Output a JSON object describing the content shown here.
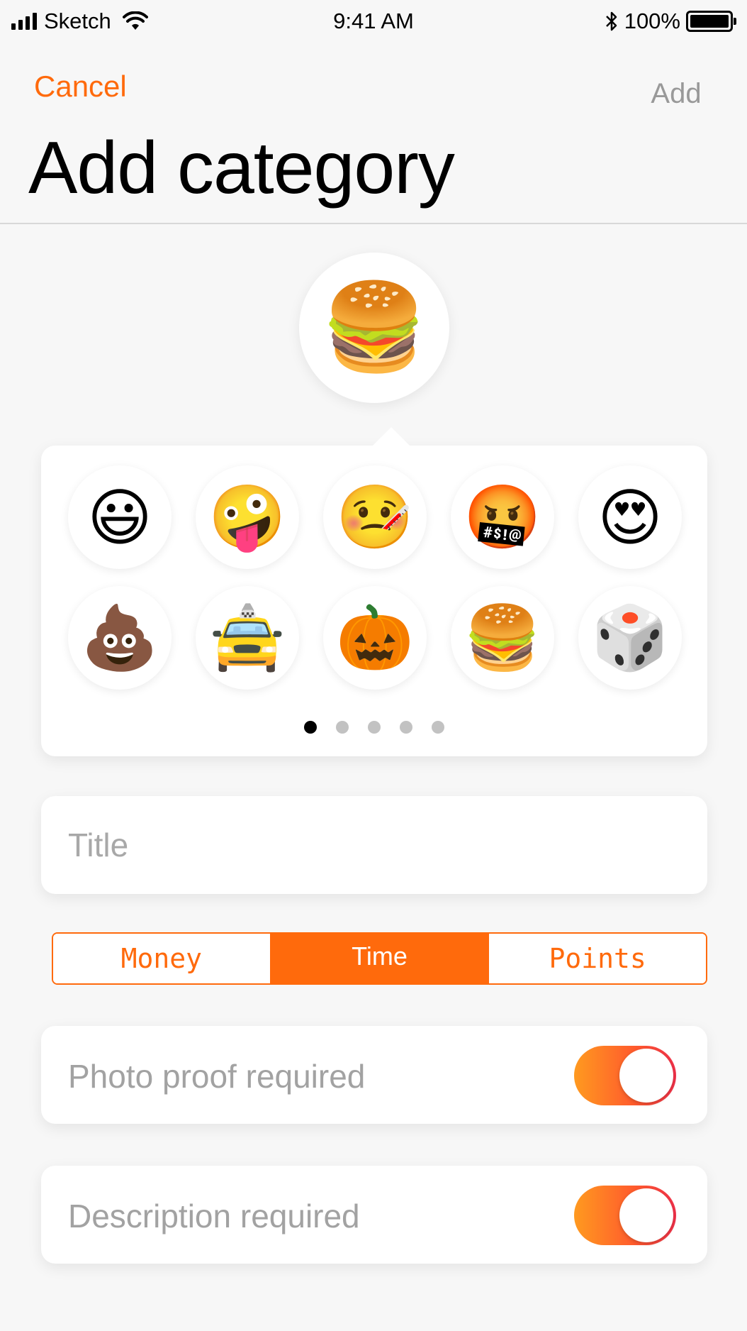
{
  "status_bar": {
    "carrier": "Sketch",
    "time": "9:41 AM",
    "battery": "100%",
    "icons": [
      "signal-icon",
      "wifi-icon",
      "bluetooth-icon",
      "battery-icon"
    ]
  },
  "header": {
    "cancel_label": "Cancel",
    "add_label": "Add",
    "title": "Add category"
  },
  "selected_emoji": "🍔",
  "picker": {
    "emojis": [
      "😃",
      "🤪",
      "🤒",
      "🤬",
      "😍",
      "💩",
      "🚖",
      "🎃",
      "🍔",
      "🎲"
    ],
    "page_count": 5,
    "active_page": 1
  },
  "title_field": {
    "placeholder": "Title",
    "value": ""
  },
  "segmented": {
    "options": [
      "Money",
      "Time",
      "Points"
    ],
    "selected": "Time"
  },
  "toggles": {
    "photo_proof": {
      "label": "Photo proof required",
      "on": true
    },
    "description": {
      "label": "Description required",
      "on": true
    }
  },
  "colors": {
    "accent": "#ff6a0c",
    "background": "#f7f7f7",
    "placeholder": "#a8a8a8"
  }
}
